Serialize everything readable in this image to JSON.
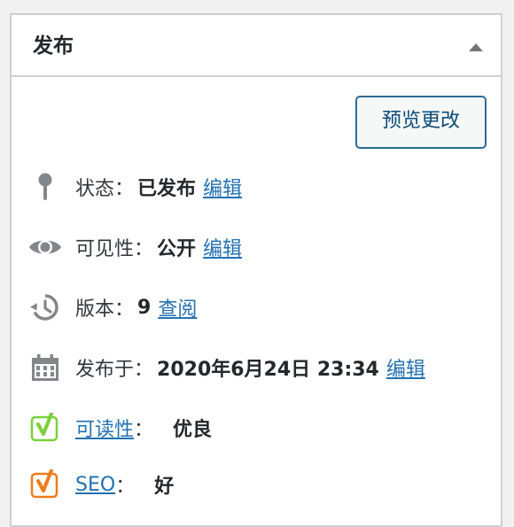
{
  "panel": {
    "title": "发布",
    "preview_button": "预览更改"
  },
  "status": {
    "label": "状态：",
    "value": "已发布",
    "action": "编辑"
  },
  "visibility": {
    "label": "可见性：",
    "value": "公开",
    "action": "编辑"
  },
  "revisions": {
    "label": "版本：",
    "value": "9",
    "action": "查阅"
  },
  "published_on": {
    "label": "发布于：",
    "value": "2020年6月24日 23:34",
    "action": "编辑"
  },
  "readability": {
    "link": "可读性",
    "separator": "：",
    "value": "优良",
    "icon_color": "#7ad03a"
  },
  "seo": {
    "link": "SEO",
    "separator": "：",
    "value": "好",
    "icon_color": "#ee7c1b"
  },
  "colors": {
    "link": "#2271b1",
    "button_border": "#2b6c95",
    "icon_gray": "#82878c"
  },
  "icons": {
    "toggle": "triangle-up-icon",
    "status": "pin-icon",
    "visibility": "eye-icon",
    "revisions": "history-icon",
    "published_on": "calendar-icon",
    "readability": "yoast-icon",
    "seo": "yoast-icon"
  }
}
